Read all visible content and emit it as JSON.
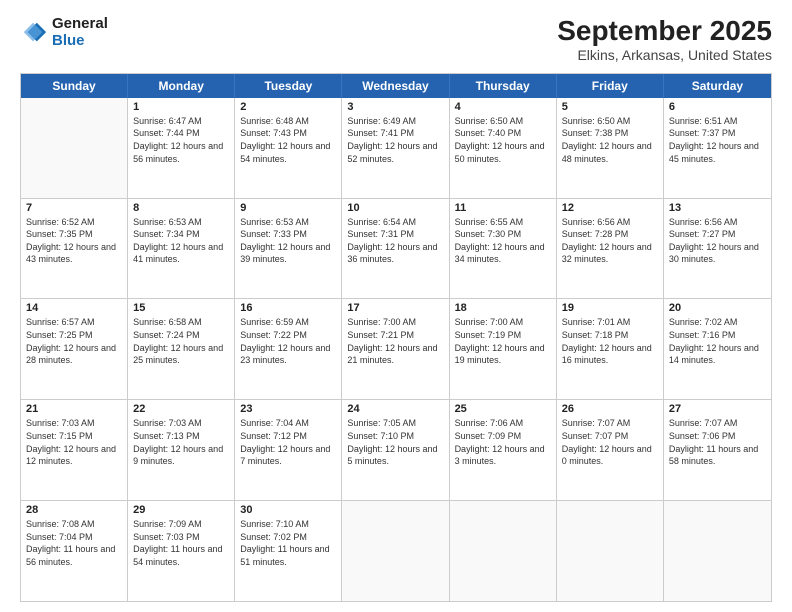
{
  "header": {
    "logo_line1": "General",
    "logo_line2": "Blue",
    "title": "September 2025",
    "subtitle": "Elkins, Arkansas, United States"
  },
  "calendar": {
    "weekdays": [
      "Sunday",
      "Monday",
      "Tuesday",
      "Wednesday",
      "Thursday",
      "Friday",
      "Saturday"
    ],
    "rows": [
      [
        {
          "day": "",
          "sunrise": "",
          "sunset": "",
          "daylight": ""
        },
        {
          "day": "1",
          "sunrise": "Sunrise: 6:47 AM",
          "sunset": "Sunset: 7:44 PM",
          "daylight": "Daylight: 12 hours and 56 minutes."
        },
        {
          "day": "2",
          "sunrise": "Sunrise: 6:48 AM",
          "sunset": "Sunset: 7:43 PM",
          "daylight": "Daylight: 12 hours and 54 minutes."
        },
        {
          "day": "3",
          "sunrise": "Sunrise: 6:49 AM",
          "sunset": "Sunset: 7:41 PM",
          "daylight": "Daylight: 12 hours and 52 minutes."
        },
        {
          "day": "4",
          "sunrise": "Sunrise: 6:50 AM",
          "sunset": "Sunset: 7:40 PM",
          "daylight": "Daylight: 12 hours and 50 minutes."
        },
        {
          "day": "5",
          "sunrise": "Sunrise: 6:50 AM",
          "sunset": "Sunset: 7:38 PM",
          "daylight": "Daylight: 12 hours and 48 minutes."
        },
        {
          "day": "6",
          "sunrise": "Sunrise: 6:51 AM",
          "sunset": "Sunset: 7:37 PM",
          "daylight": "Daylight: 12 hours and 45 minutes."
        }
      ],
      [
        {
          "day": "7",
          "sunrise": "Sunrise: 6:52 AM",
          "sunset": "Sunset: 7:35 PM",
          "daylight": "Daylight: 12 hours and 43 minutes."
        },
        {
          "day": "8",
          "sunrise": "Sunrise: 6:53 AM",
          "sunset": "Sunset: 7:34 PM",
          "daylight": "Daylight: 12 hours and 41 minutes."
        },
        {
          "day": "9",
          "sunrise": "Sunrise: 6:53 AM",
          "sunset": "Sunset: 7:33 PM",
          "daylight": "Daylight: 12 hours and 39 minutes."
        },
        {
          "day": "10",
          "sunrise": "Sunrise: 6:54 AM",
          "sunset": "Sunset: 7:31 PM",
          "daylight": "Daylight: 12 hours and 36 minutes."
        },
        {
          "day": "11",
          "sunrise": "Sunrise: 6:55 AM",
          "sunset": "Sunset: 7:30 PM",
          "daylight": "Daylight: 12 hours and 34 minutes."
        },
        {
          "day": "12",
          "sunrise": "Sunrise: 6:56 AM",
          "sunset": "Sunset: 7:28 PM",
          "daylight": "Daylight: 12 hours and 32 minutes."
        },
        {
          "day": "13",
          "sunrise": "Sunrise: 6:56 AM",
          "sunset": "Sunset: 7:27 PM",
          "daylight": "Daylight: 12 hours and 30 minutes."
        }
      ],
      [
        {
          "day": "14",
          "sunrise": "Sunrise: 6:57 AM",
          "sunset": "Sunset: 7:25 PM",
          "daylight": "Daylight: 12 hours and 28 minutes."
        },
        {
          "day": "15",
          "sunrise": "Sunrise: 6:58 AM",
          "sunset": "Sunset: 7:24 PM",
          "daylight": "Daylight: 12 hours and 25 minutes."
        },
        {
          "day": "16",
          "sunrise": "Sunrise: 6:59 AM",
          "sunset": "Sunset: 7:22 PM",
          "daylight": "Daylight: 12 hours and 23 minutes."
        },
        {
          "day": "17",
          "sunrise": "Sunrise: 7:00 AM",
          "sunset": "Sunset: 7:21 PM",
          "daylight": "Daylight: 12 hours and 21 minutes."
        },
        {
          "day": "18",
          "sunrise": "Sunrise: 7:00 AM",
          "sunset": "Sunset: 7:19 PM",
          "daylight": "Daylight: 12 hours and 19 minutes."
        },
        {
          "day": "19",
          "sunrise": "Sunrise: 7:01 AM",
          "sunset": "Sunset: 7:18 PM",
          "daylight": "Daylight: 12 hours and 16 minutes."
        },
        {
          "day": "20",
          "sunrise": "Sunrise: 7:02 AM",
          "sunset": "Sunset: 7:16 PM",
          "daylight": "Daylight: 12 hours and 14 minutes."
        }
      ],
      [
        {
          "day": "21",
          "sunrise": "Sunrise: 7:03 AM",
          "sunset": "Sunset: 7:15 PM",
          "daylight": "Daylight: 12 hours and 12 minutes."
        },
        {
          "day": "22",
          "sunrise": "Sunrise: 7:03 AM",
          "sunset": "Sunset: 7:13 PM",
          "daylight": "Daylight: 12 hours and 9 minutes."
        },
        {
          "day": "23",
          "sunrise": "Sunrise: 7:04 AM",
          "sunset": "Sunset: 7:12 PM",
          "daylight": "Daylight: 12 hours and 7 minutes."
        },
        {
          "day": "24",
          "sunrise": "Sunrise: 7:05 AM",
          "sunset": "Sunset: 7:10 PM",
          "daylight": "Daylight: 12 hours and 5 minutes."
        },
        {
          "day": "25",
          "sunrise": "Sunrise: 7:06 AM",
          "sunset": "Sunset: 7:09 PM",
          "daylight": "Daylight: 12 hours and 3 minutes."
        },
        {
          "day": "26",
          "sunrise": "Sunrise: 7:07 AM",
          "sunset": "Sunset: 7:07 PM",
          "daylight": "Daylight: 12 hours and 0 minutes."
        },
        {
          "day": "27",
          "sunrise": "Sunrise: 7:07 AM",
          "sunset": "Sunset: 7:06 PM",
          "daylight": "Daylight: 11 hours and 58 minutes."
        }
      ],
      [
        {
          "day": "28",
          "sunrise": "Sunrise: 7:08 AM",
          "sunset": "Sunset: 7:04 PM",
          "daylight": "Daylight: 11 hours and 56 minutes."
        },
        {
          "day": "29",
          "sunrise": "Sunrise: 7:09 AM",
          "sunset": "Sunset: 7:03 PM",
          "daylight": "Daylight: 11 hours and 54 minutes."
        },
        {
          "day": "30",
          "sunrise": "Sunrise: 7:10 AM",
          "sunset": "Sunset: 7:02 PM",
          "daylight": "Daylight: 11 hours and 51 minutes."
        },
        {
          "day": "",
          "sunrise": "",
          "sunset": "",
          "daylight": ""
        },
        {
          "day": "",
          "sunrise": "",
          "sunset": "",
          "daylight": ""
        },
        {
          "day": "",
          "sunrise": "",
          "sunset": "",
          "daylight": ""
        },
        {
          "day": "",
          "sunrise": "",
          "sunset": "",
          "daylight": ""
        }
      ]
    ]
  }
}
